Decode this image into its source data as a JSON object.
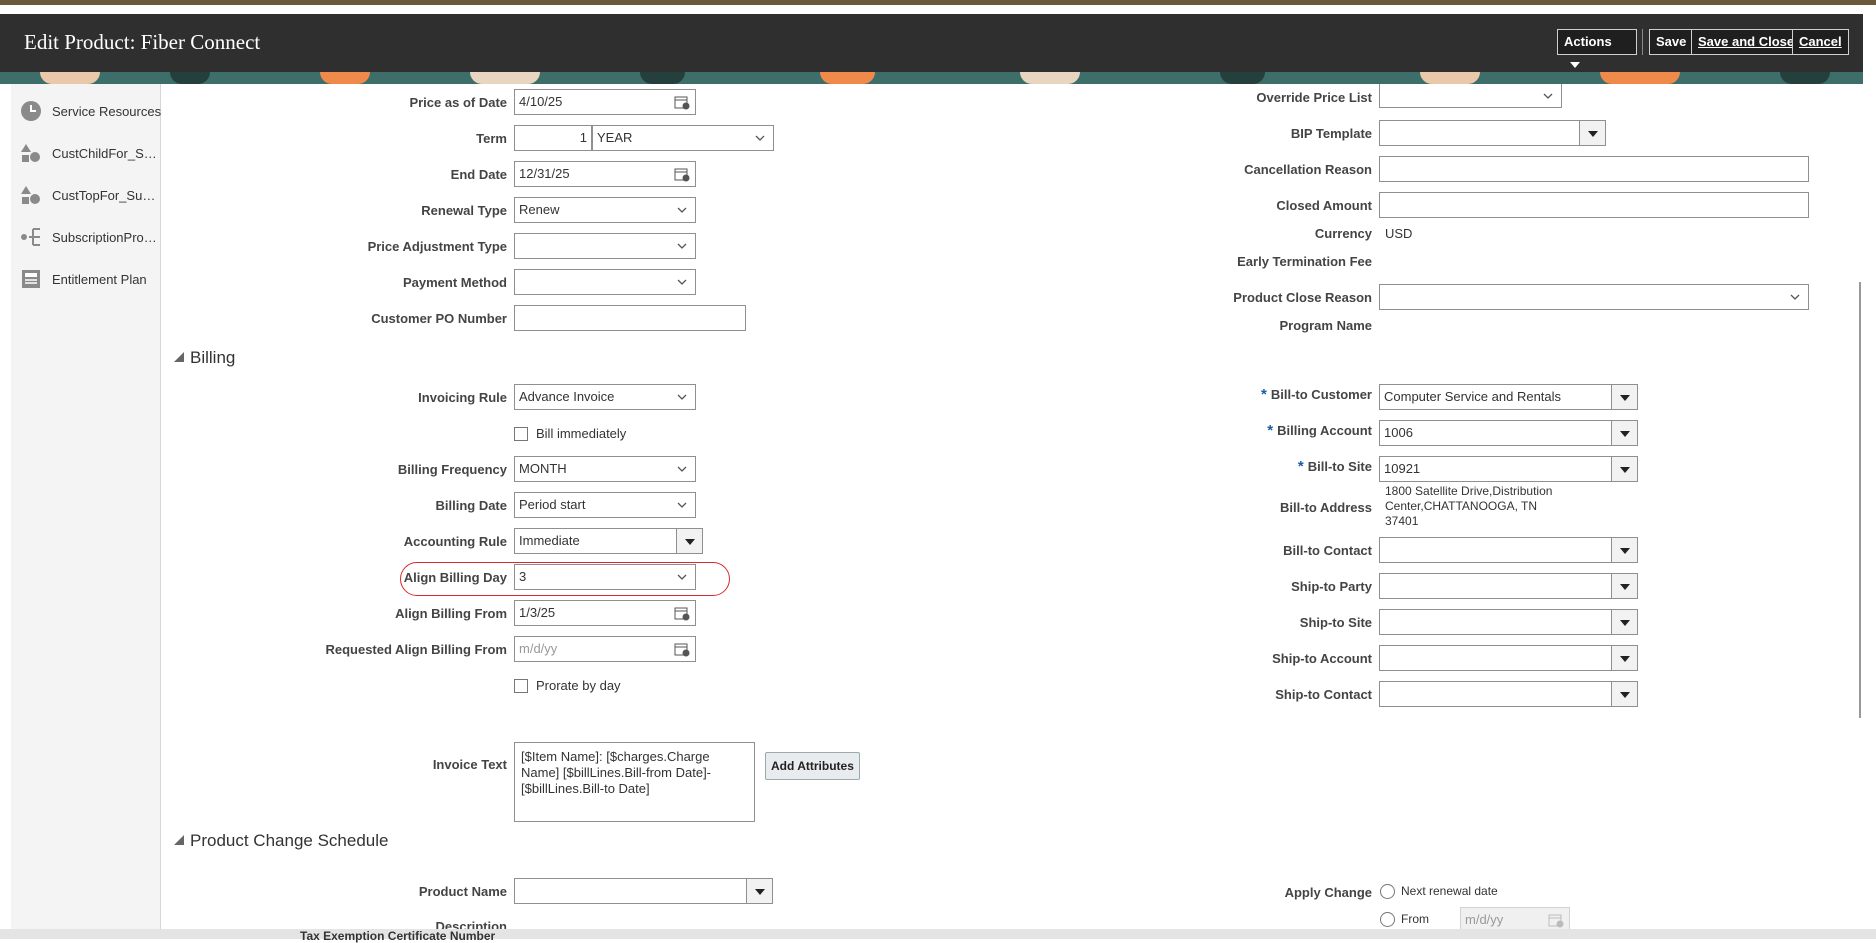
{
  "header": {
    "title": "Edit Product: Fiber Connect",
    "actions_label": "Actions",
    "save_label": "Save",
    "save_close_label": "Save and Close",
    "cancel_label": "Cancel"
  },
  "sidebar": {
    "items": [
      {
        "label": "Service Resources",
        "icon": "clock-icon"
      },
      {
        "label": "CustChildFor_Subscription",
        "icon": "shapes-icon"
      },
      {
        "label": "CustTopFor_Subscription",
        "icon": "shapes-icon"
      },
      {
        "label": "SubscriptionProducts",
        "icon": "hierarchy-icon"
      },
      {
        "label": "Entitlement Plan",
        "icon": "document-icon"
      }
    ]
  },
  "general": {
    "price_as_of_date": {
      "label": "Price as of Date",
      "value": "4/10/25"
    },
    "term": {
      "label": "Term",
      "value": "1",
      "unit": "YEAR"
    },
    "end_date": {
      "label": "End Date",
      "value": "12/31/25"
    },
    "renewal_type": {
      "label": "Renewal Type",
      "value": "Renew"
    },
    "price_adjustment_type": {
      "label": "Price Adjustment Type",
      "value": ""
    },
    "payment_method": {
      "label": "Payment Method",
      "value": ""
    },
    "customer_po_number": {
      "label": "Customer PO Number",
      "value": ""
    },
    "override_price_list": {
      "label": "Override Price List",
      "value": ""
    },
    "bip_template": {
      "label": "BIP Template",
      "value": ""
    },
    "cancellation_reason": {
      "label": "Cancellation Reason",
      "value": ""
    },
    "closed_amount": {
      "label": "Closed Amount",
      "value": ""
    },
    "currency": {
      "label": "Currency",
      "value": "USD"
    },
    "early_termination_fee": {
      "label": "Early Termination Fee",
      "value": ""
    },
    "product_close_reason": {
      "label": "Product Close Reason",
      "value": ""
    },
    "program_name": {
      "label": "Program Name",
      "value": ""
    }
  },
  "billing": {
    "section_title": "Billing",
    "invoicing_rule": {
      "label": "Invoicing Rule",
      "value": "Advance Invoice"
    },
    "bill_immediately": {
      "label": "Bill immediately",
      "checked": false
    },
    "billing_frequency": {
      "label": "Billing Frequency",
      "value": "MONTH"
    },
    "billing_date": {
      "label": "Billing Date",
      "value": "Period start"
    },
    "accounting_rule": {
      "label": "Accounting Rule",
      "value": "Immediate"
    },
    "align_billing_day": {
      "label": "Align Billing Day",
      "value": "3"
    },
    "align_billing_from": {
      "label": "Align Billing From",
      "value": "1/3/25"
    },
    "requested_align_billing_from": {
      "label": "Requested Align Billing From",
      "placeholder": "m/d/yy"
    },
    "prorate_by_day": {
      "label": "Prorate by day",
      "checked": false
    },
    "invoice_text": {
      "label": "Invoice Text",
      "value": "[$Item Name]: [$charges.Charge Name] [$billLines.Bill-from Date]-[$billLines.Bill-to Date]"
    },
    "add_attributes_label": "Add Attributes",
    "bill_to_customer": {
      "label": "Bill-to Customer",
      "value": "Computer Service and Rentals"
    },
    "billing_account": {
      "label": "Billing Account",
      "value": "1006"
    },
    "bill_to_site": {
      "label": "Bill-to Site",
      "value": "10921"
    },
    "bill_to_address": {
      "label": "Bill-to Address",
      "line1": "1800 Satellite Drive,Distribution",
      "line2": "Center,CHATTANOOGA, TN",
      "line3": "37401"
    },
    "bill_to_contact": {
      "label": "Bill-to Contact",
      "value": ""
    },
    "ship_to_party": {
      "label": "Ship-to Party",
      "value": ""
    },
    "ship_to_site": {
      "label": "Ship-to Site",
      "value": ""
    },
    "ship_to_account": {
      "label": "Ship-to Account",
      "value": ""
    },
    "ship_to_contact": {
      "label": "Ship-to Contact",
      "value": ""
    }
  },
  "change_schedule": {
    "section_title": "Product Change Schedule",
    "product_name": {
      "label": "Product Name",
      "value": ""
    },
    "description": {
      "label": "Description"
    },
    "apply_change": {
      "label": "Apply Change",
      "option_next": "Next renewal date",
      "option_from": "From",
      "from_placeholder": "m/d/yy"
    }
  },
  "footer": {
    "partial_label": "Tax Exemption Certificate Number"
  },
  "colors": {
    "header_bg": "#2f2f2f",
    "banner_bg": "#3d6e6a",
    "highlight": "#d62b2b",
    "required": "#1a5aa8"
  }
}
